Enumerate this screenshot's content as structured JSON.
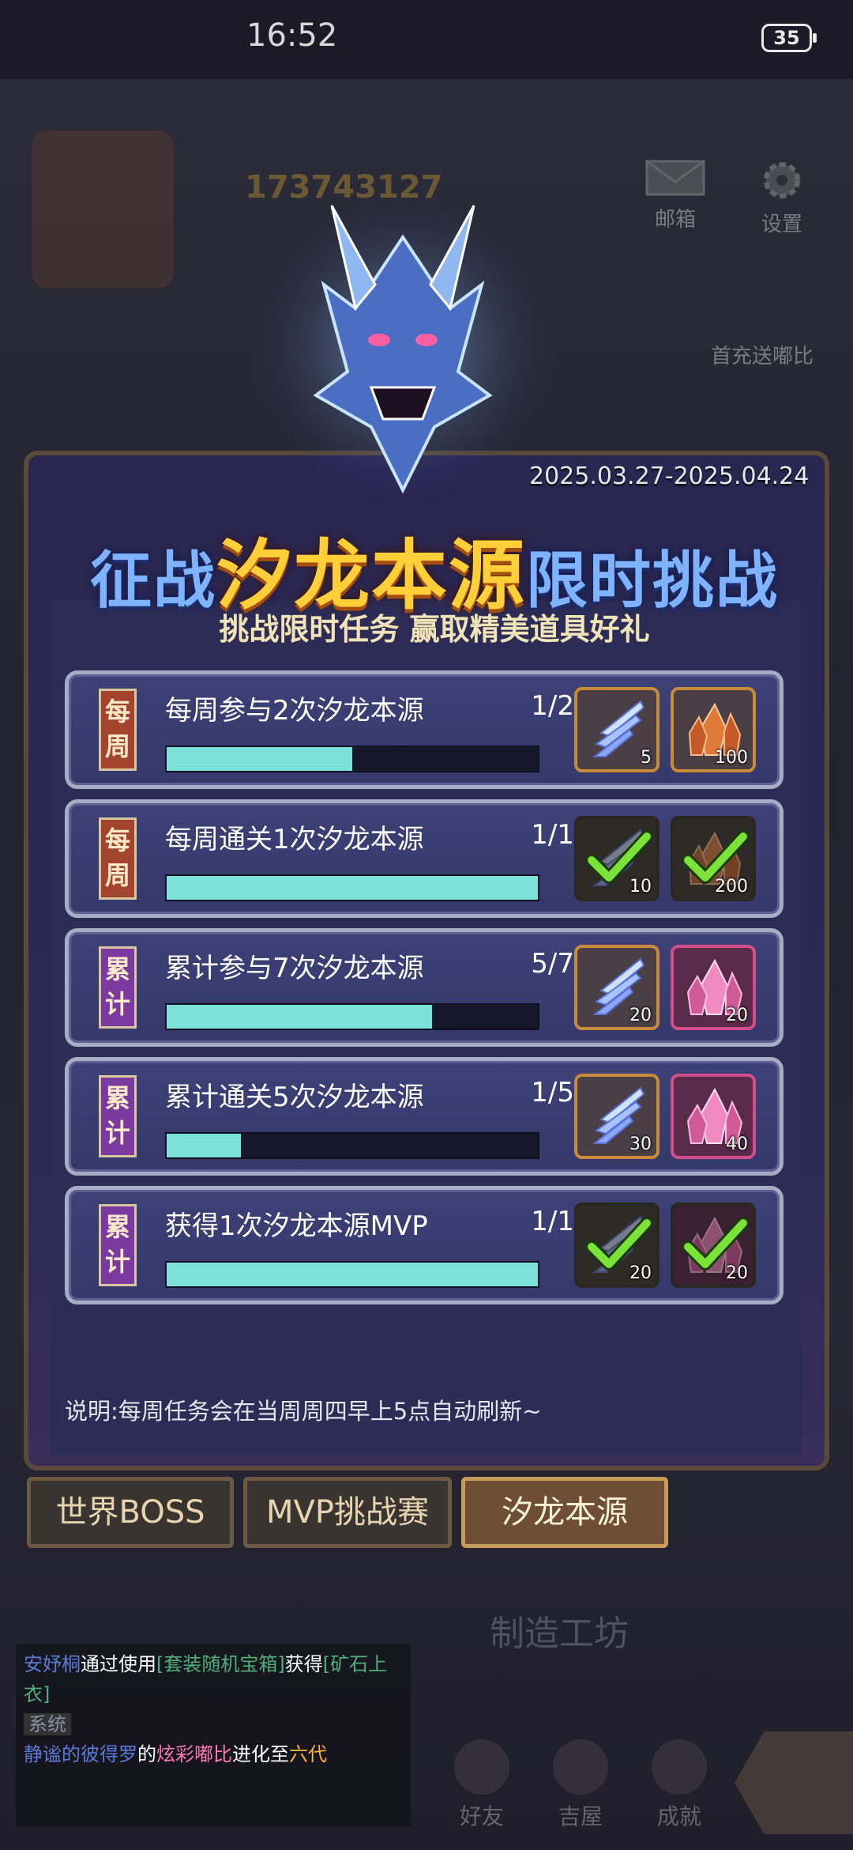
{
  "status_bar": {
    "time": "16:52",
    "battery": "35"
  },
  "background": {
    "coins": "173743127",
    "mail_label": "邮箱",
    "settings_label": "设置",
    "first_charge_label": "首充送嘟比",
    "workshop_label": "制造工坊",
    "chat": {
      "line1_name": "安妤桐",
      "line1_text_a": "通过使用",
      "line1_item": "[套装随机宝箱]",
      "line1_text_b": "获得",
      "line1_reward": "[矿石上衣]",
      "system_tag": "系统",
      "line2_name": "静谧的彼得罗",
      "line2_text_a": "的",
      "line2_pet": "炫彩嘟比",
      "line2_text_b": "进化至",
      "line2_stage": "六代"
    },
    "nav": [
      {
        "label": "好友"
      },
      {
        "label": "吉屋"
      },
      {
        "label": "成就"
      }
    ]
  },
  "event": {
    "date_range": "2025.03.27-2025.04.24",
    "title_prefix": "征战",
    "title_highlight": "汐龙本源",
    "title_suffix": "限时挑战",
    "subtitle": "挑战限时任务 赢取精美道具好礼",
    "note": "说明:每周任务会在当周周四早上5点自动刷新~"
  },
  "tasks": [
    {
      "tag": "每周",
      "tag_type": "weekly",
      "name": "每周参与2次汐龙本源",
      "progress": "1/2",
      "fraction": 0.5,
      "rewards": [
        {
          "icon": "blue-claw-icon",
          "qty": "5",
          "claimed": false,
          "frame": "gold"
        },
        {
          "icon": "orange-crystal-icon",
          "qty": "100",
          "claimed": false,
          "frame": "gold"
        }
      ]
    },
    {
      "tag": "每周",
      "tag_type": "weekly",
      "name": "每周通关1次汐龙本源",
      "progress": "1/1",
      "fraction": 1.0,
      "rewards": [
        {
          "icon": "blue-claw-icon",
          "qty": "10",
          "claimed": true,
          "frame": "gold"
        },
        {
          "icon": "orange-crystal-icon",
          "qty": "200",
          "claimed": true,
          "frame": "gold"
        }
      ]
    },
    {
      "tag": "累计",
      "tag_type": "total",
      "name": "累计参与7次汐龙本源",
      "progress": "5/7",
      "fraction": 0.714,
      "rewards": [
        {
          "icon": "blue-claw-icon",
          "qty": "20",
          "claimed": false,
          "frame": "gold"
        },
        {
          "icon": "pink-crystal-icon",
          "qty": "20",
          "claimed": false,
          "frame": "pink"
        }
      ]
    },
    {
      "tag": "累计",
      "tag_type": "total",
      "name": "累计通关5次汐龙本源",
      "progress": "1/5",
      "fraction": 0.2,
      "rewards": [
        {
          "icon": "blue-claw-icon",
          "qty": "30",
          "claimed": false,
          "frame": "gold"
        },
        {
          "icon": "pink-crystal-icon",
          "qty": "40",
          "claimed": false,
          "frame": "pink"
        }
      ]
    },
    {
      "tag": "累计",
      "tag_type": "total",
      "name": "获得1次汐龙本源MVP",
      "progress": "1/1",
      "fraction": 1.0,
      "rewards": [
        {
          "icon": "blue-claw-icon",
          "qty": "20",
          "claimed": true,
          "frame": "gold"
        },
        {
          "icon": "pink-crystal-icon",
          "qty": "20",
          "claimed": true,
          "frame": "pink"
        }
      ]
    }
  ],
  "tabs": [
    {
      "label": "世界BOSS",
      "active": false
    },
    {
      "label": "MVP挑战赛",
      "active": false
    },
    {
      "label": "汐龙本源",
      "active": true
    }
  ],
  "colors": {
    "progress_fill": "#7be2d9",
    "weekly_tag": "#a2442e",
    "total_tag": "#7a3aa0",
    "title_highlight": "#ffcf3a",
    "title_text": "#7fb2ff"
  }
}
